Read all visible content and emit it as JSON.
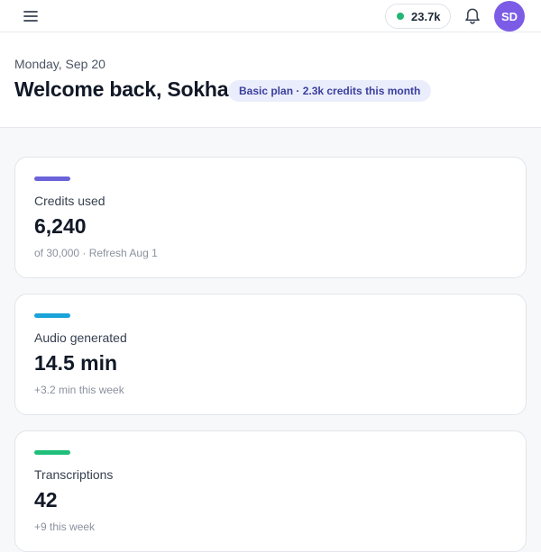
{
  "topbar": {
    "credits_balance": "23.7k",
    "credits_status_color": "#22b573",
    "avatar_initials": "SD",
    "avatar_color": "#7c5ce6",
    "menu_icon": "hamburger-menu-icon",
    "bell_icon": "bell-icon"
  },
  "header": {
    "date": "Monday, Sep 20",
    "welcome": "Welcome back, Sokha",
    "plan_badge": "Basic plan · 2.3k credits this month"
  },
  "cards": [
    {
      "label": "Credits used",
      "value": "6,240",
      "note": "of 30,000 · Refresh Aug 1",
      "accent": "#6b63d9"
    },
    {
      "label": "Audio generated",
      "value": "14.5 min",
      "note": "+3.2 min this week",
      "accent": "#1aa3d9"
    },
    {
      "label": "Transcriptions",
      "value": "42",
      "note": "+9 this week",
      "accent": "#1fbf7a"
    }
  ]
}
